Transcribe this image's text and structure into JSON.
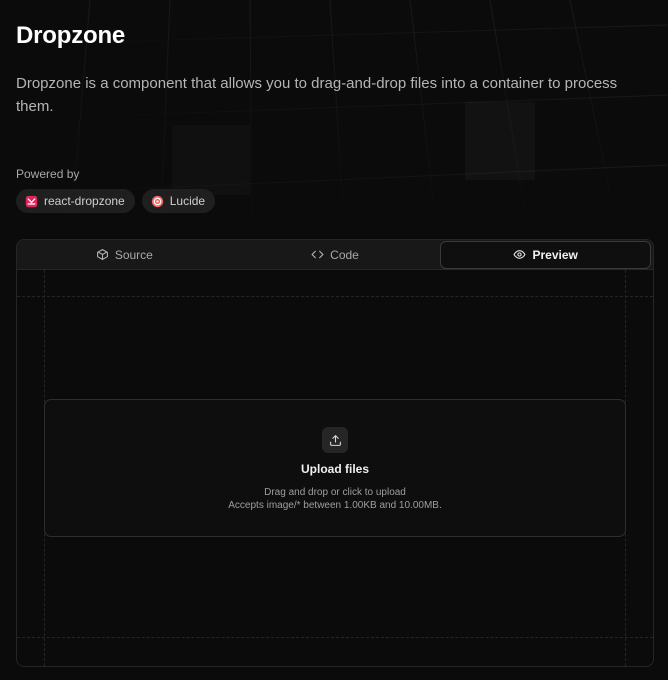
{
  "header": {
    "title": "Dropzone",
    "description": "Dropzone is a component that allows you to drag-and-drop files into a container to process them."
  },
  "powered_by": {
    "label": "Powered by",
    "chips": [
      {
        "label": "react-dropzone",
        "icon": "react-dropzone-logo-icon",
        "color": "#e0245e"
      },
      {
        "label": "Lucide",
        "icon": "lucide-logo-icon",
        "color": "#f56565"
      }
    ]
  },
  "tabs": [
    {
      "label": "Source",
      "icon": "box-icon",
      "active": false
    },
    {
      "label": "Code",
      "icon": "code-icon",
      "active": false
    },
    {
      "label": "Preview",
      "icon": "eye-icon",
      "active": true
    }
  ],
  "dropzone": {
    "title": "Upload files",
    "hint": "Drag and drop or click to upload",
    "accept": "Accepts image/* between 1.00KB and 10.00MB.",
    "icon": "upload-icon"
  },
  "colors": {
    "background": "#0b0b0b",
    "surface": "#181818",
    "border": "#262626",
    "text": "#ededed",
    "muted": "#a9a9a9"
  }
}
